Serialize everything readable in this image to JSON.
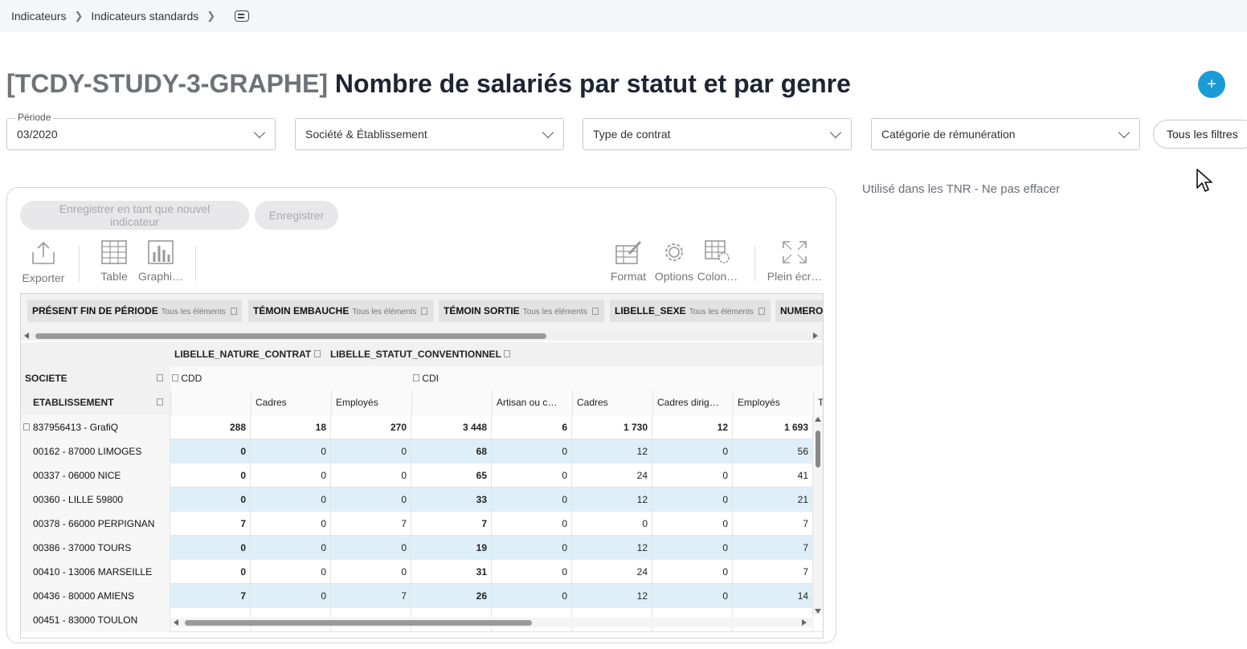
{
  "breadcrumb": {
    "item1": "Indicateurs",
    "item2": "Indicateurs standards"
  },
  "title": {
    "code": "[TCDY-STUDY-3-GRAPHE]",
    "name": "Nombre de salariés par statut et par genre"
  },
  "add_label": "+",
  "filters": {
    "periode_label": "Période",
    "periode_value": "03/2020",
    "societe": "Société & Établissement",
    "contrat": "Type de contrat",
    "remuneration": "Catégorie de rémunération",
    "all": "Tous les filtres"
  },
  "note": "Utilisé dans les TNR - Ne pas effacer",
  "actions": {
    "save_new": "Enregistrer en tant que nouvel indicateur",
    "save": "Enregistrer"
  },
  "toolbar": {
    "export": "Exporter",
    "table": "Table",
    "graph": "Graphi…",
    "format": "Format",
    "options": "Options",
    "columns": "Colon…",
    "fullscreen": "Plein écr…"
  },
  "chips": [
    {
      "name": "PRÉSENT FIN DE PÉRIODE",
      "sub": "Tous les éléments"
    },
    {
      "name": "TÉMOIN EMBAUCHE",
      "sub": "Tous les éléments"
    },
    {
      "name": "TÉMOIN SORTIE",
      "sub": "Tous les éléments"
    },
    {
      "name": "LIBELLE_SEXE",
      "sub": "Tous les éléments"
    },
    {
      "name": "NUMERO",
      "sub": ""
    }
  ],
  "pivot": {
    "col_field1": "LIBELLE_NATURE_CONTRAT",
    "col_field2": "LIBELLE_STATUT_CONVENTIONNEL",
    "row_field1": "SOCIETE",
    "row_field2": "ETABLISSEMENT",
    "group_cdd": "CDD",
    "group_cdi": "CDI",
    "sub_headers": [
      "",
      "Cadres",
      "Employés",
      "",
      "Artisan ou c…",
      "Cadres",
      "Cadres dirig…",
      "Employés",
      "T"
    ],
    "rows": [
      {
        "label": "837956413 - GrafiQ",
        "values": [
          "288",
          "18",
          "270",
          "3 448",
          "6",
          "1 730",
          "12",
          "1 693"
        ],
        "total": true
      },
      {
        "label": "00162 - 87000 LIMOGES",
        "values": [
          "0",
          "0",
          "0",
          "68",
          "0",
          "12",
          "0",
          "56"
        ]
      },
      {
        "label": "00337 - 06000 NICE",
        "values": [
          "0",
          "0",
          "0",
          "65",
          "0",
          "24",
          "0",
          "41"
        ]
      },
      {
        "label": "00360 - LILLE 59800",
        "values": [
          "0",
          "0",
          "0",
          "33",
          "0",
          "12",
          "0",
          "21"
        ]
      },
      {
        "label": "00378 - 66000 PERPIGNAN",
        "values": [
          "7",
          "0",
          "7",
          "7",
          "0",
          "0",
          "0",
          "7"
        ]
      },
      {
        "label": "00386 - 37000 TOURS",
        "values": [
          "0",
          "0",
          "0",
          "19",
          "0",
          "12",
          "0",
          "7"
        ]
      },
      {
        "label": "00410 - 13006 MARSEILLE",
        "values": [
          "0",
          "0",
          "0",
          "31",
          "0",
          "24",
          "0",
          "7"
        ]
      },
      {
        "label": "00436 - 80000 AMIENS",
        "values": [
          "7",
          "0",
          "7",
          "26",
          "0",
          "12",
          "0",
          "14"
        ]
      },
      {
        "label": "00451 - 83000 TOULON",
        "values": [
          "",
          "",
          "",
          "",
          "",
          "",
          "",
          ""
        ]
      }
    ]
  }
}
